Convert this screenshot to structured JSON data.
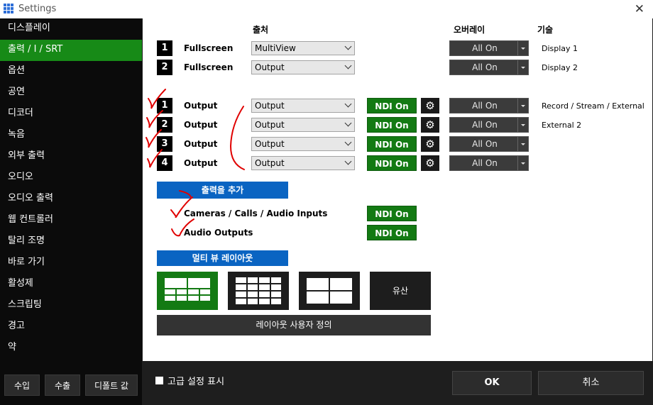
{
  "window": {
    "title": "Settings"
  },
  "sidebar": {
    "items": [
      {
        "label": "디스플레이",
        "active": false
      },
      {
        "label": "출력 / I / SRT",
        "active": true
      },
      {
        "label": "옵션",
        "active": false
      },
      {
        "label": "공연",
        "active": false
      },
      {
        "label": "디코더",
        "active": false
      },
      {
        "label": "녹음",
        "active": false
      },
      {
        "label": "외부 출력",
        "active": false
      },
      {
        "label": "오디오",
        "active": false
      },
      {
        "label": "오디오 출력",
        "active": false
      },
      {
        "label": "웹 컨트롤러",
        "active": false
      },
      {
        "label": "탈리 조명",
        "active": false
      },
      {
        "label": "바로 가기",
        "active": false
      },
      {
        "label": "활성제",
        "active": false
      },
      {
        "label": "스크립팅",
        "active": false
      },
      {
        "label": "경고",
        "active": false
      },
      {
        "label": "약",
        "active": false
      }
    ],
    "import_label": "수입",
    "export_label": "수출",
    "defaults_label": "디폴트 값"
  },
  "headers": {
    "source": "출처",
    "overlay": "오버레이",
    "tech": "기술"
  },
  "fullscreen_rows": [
    {
      "num": "1",
      "label": "Fullscreen",
      "source": "MultiView",
      "overlay": "All On",
      "tech": "Display 1"
    },
    {
      "num": "2",
      "label": "Fullscreen",
      "source": "Output",
      "overlay": "All On",
      "tech": "Display 2"
    }
  ],
  "output_rows": [
    {
      "num": "1",
      "label": "Output",
      "source": "Output",
      "ndi": "NDI On",
      "overlay": "All On",
      "tech": "Record / Stream / External"
    },
    {
      "num": "2",
      "label": "Output",
      "source": "Output",
      "ndi": "NDI On",
      "overlay": "All On",
      "tech": "External 2"
    },
    {
      "num": "3",
      "label": "Output",
      "source": "Output",
      "ndi": "NDI On",
      "overlay": "All On",
      "tech": ""
    },
    {
      "num": "4",
      "label": "Output",
      "source": "Output",
      "ndi": "NDI On",
      "overlay": "All On",
      "tech": ""
    }
  ],
  "add_output_label": "출력을 추가",
  "ndi_extras": [
    {
      "label": "Cameras / Calls / Audio Inputs",
      "ndi": "NDI On"
    },
    {
      "label": "Audio Outputs",
      "ndi": "NDI On"
    }
  ],
  "multiview": {
    "title": "멀티 뷰 레이아웃",
    "legacy_label": "유산",
    "customize_label": "레이아웃 사용자 정의"
  },
  "footer": {
    "advanced_label": "고급 설정 표시",
    "ok_label": "OK",
    "cancel_label": "취소"
  },
  "colors": {
    "accent_green": "#137a13",
    "accent_blue": "#0a64c2",
    "annotation_red": "#e00000"
  }
}
